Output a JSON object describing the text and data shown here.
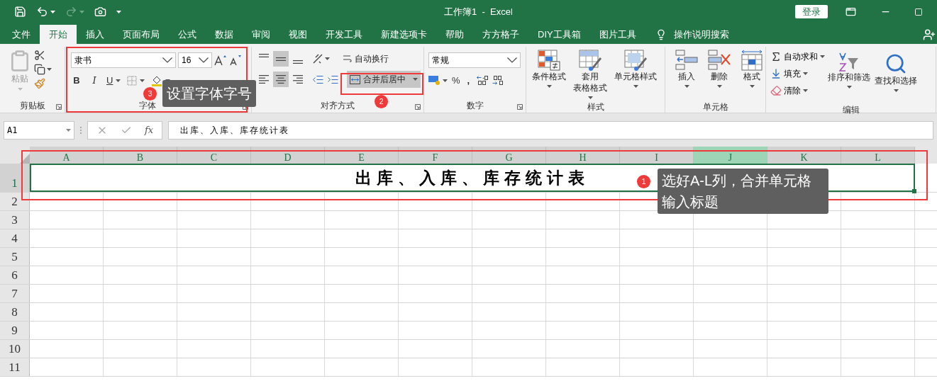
{
  "title_bar": {
    "title": "工作簿1  -  Excel",
    "login_button": "登录"
  },
  "tabs": [
    {
      "label": "文件",
      "selected": false
    },
    {
      "label": "开始",
      "selected": true
    },
    {
      "label": "插入",
      "selected": false
    },
    {
      "label": "页面布局",
      "selected": false
    },
    {
      "label": "公式",
      "selected": false
    },
    {
      "label": "数据",
      "selected": false
    },
    {
      "label": "审阅",
      "selected": false
    },
    {
      "label": "视图",
      "selected": false
    },
    {
      "label": "开发工具",
      "selected": false
    },
    {
      "label": "新建选项卡",
      "selected": false
    },
    {
      "label": "帮助",
      "selected": false
    },
    {
      "label": "方方格子",
      "selected": false
    },
    {
      "label": "DIY工具箱",
      "selected": false
    },
    {
      "label": "图片工具",
      "selected": false
    }
  ],
  "tell_me": "操作说明搜索",
  "ribbon": {
    "clipboard": {
      "label": "剪贴板",
      "paste": "粘贴"
    },
    "font": {
      "label": "字体",
      "font_name": "隶书",
      "font_size": "16",
      "bold": "B",
      "italic": "I",
      "underline": "U"
    },
    "alignment": {
      "label": "对齐方式",
      "wrap_text": "自动换行",
      "merge_center": "合并后居中",
      "vertical": [
        {
          "pressed": false
        },
        {
          "pressed": true
        },
        {
          "pressed": false
        }
      ],
      "horizontal": [
        {
          "pressed": false
        },
        {
          "pressed": true
        },
        {
          "pressed": false
        }
      ]
    },
    "number": {
      "label": "数字",
      "format": "常规",
      "percent": "%",
      "comma": ","
    },
    "styles": {
      "label": "样式",
      "buttons": [
        {
          "lines": [
            "条件格式"
          ]
        },
        {
          "lines": [
            "套用",
            "表格格式"
          ]
        },
        {
          "lines": [
            "单元格样式"
          ]
        }
      ]
    },
    "cells": {
      "label": "单元格",
      "buttons": [
        {
          "lines": [
            "插入"
          ]
        },
        {
          "lines": [
            "删除"
          ]
        },
        {
          "lines": [
            "格式"
          ]
        }
      ]
    },
    "editing": {
      "label": "编辑",
      "autosum": "自动求和",
      "fill": "填充",
      "clear": "清除",
      "sort": "排序和筛选",
      "find": "查找和选择"
    }
  },
  "formula_bar": {
    "name_box": "A1",
    "function_button": "fx",
    "formula": "出库、入库、库存统计表"
  },
  "columns": [
    {
      "label": "A",
      "selected": false
    },
    {
      "label": "B",
      "selected": false
    },
    {
      "label": "C",
      "selected": false
    },
    {
      "label": "D",
      "selected": false
    },
    {
      "label": "E",
      "selected": false
    },
    {
      "label": "F",
      "selected": false
    },
    {
      "label": "G",
      "selected": false
    },
    {
      "label": "H",
      "selected": false
    },
    {
      "label": "I",
      "selected": false
    },
    {
      "label": "J",
      "selected": true
    },
    {
      "label": "K",
      "selected": false
    },
    {
      "label": "L",
      "selected": false
    }
  ],
  "rows": [
    "1",
    "2",
    "3",
    "4",
    "5",
    "6",
    "7",
    "8",
    "9",
    "10",
    "11"
  ],
  "merged_cell": "出库、入库、库存统计表",
  "annotations": [
    {
      "number": "1",
      "lines": [
        "选好A-L列，合并单元格",
        "输入标题"
      ]
    },
    {
      "number": "2"
    },
    {
      "number": "3",
      "lines": [
        "设置字体字号"
      ]
    }
  ]
}
